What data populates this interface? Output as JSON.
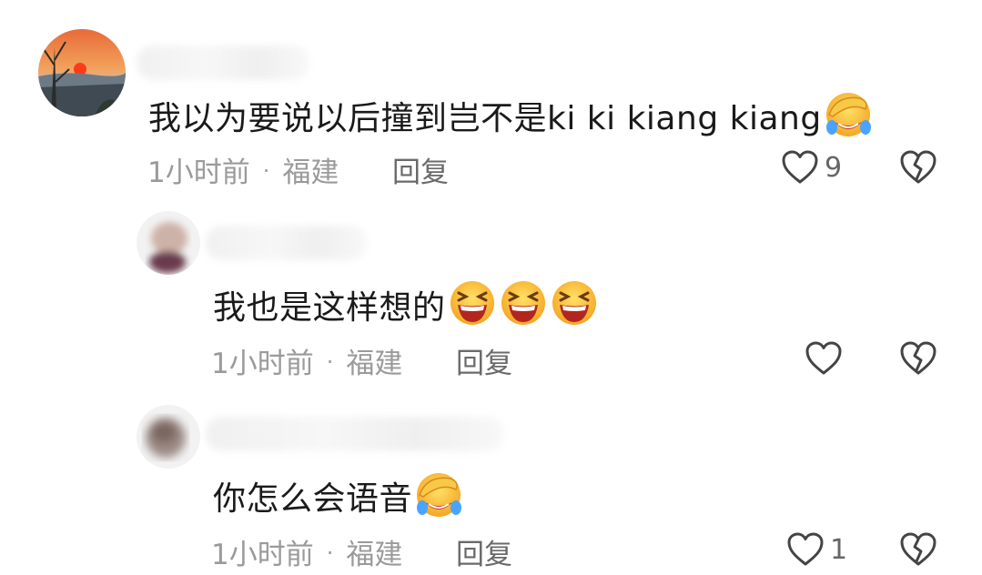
{
  "comments": [
    {
      "text": "我以为要说以后撞到岂不是ki ki kiang kiang",
      "time": "1小时前",
      "location": "福建",
      "reply_label": "回复",
      "like_count": "9"
    },
    {
      "text": "我也是这样想的",
      "time": "1小时前",
      "location": "福建",
      "reply_label": "回复",
      "like_count": ""
    },
    {
      "text": "你怎么会语音",
      "time": "1小时前",
      "location": "福建",
      "reply_label": "回复",
      "like_count": "1"
    }
  ],
  "separator": "·",
  "icons": {
    "like": "heart-outline-icon",
    "dislike": "broken-heart-icon",
    "emoji_face_palm": "facepalm-laugh-emoji",
    "emoji_laugh": "grinning-squint-emoji"
  }
}
